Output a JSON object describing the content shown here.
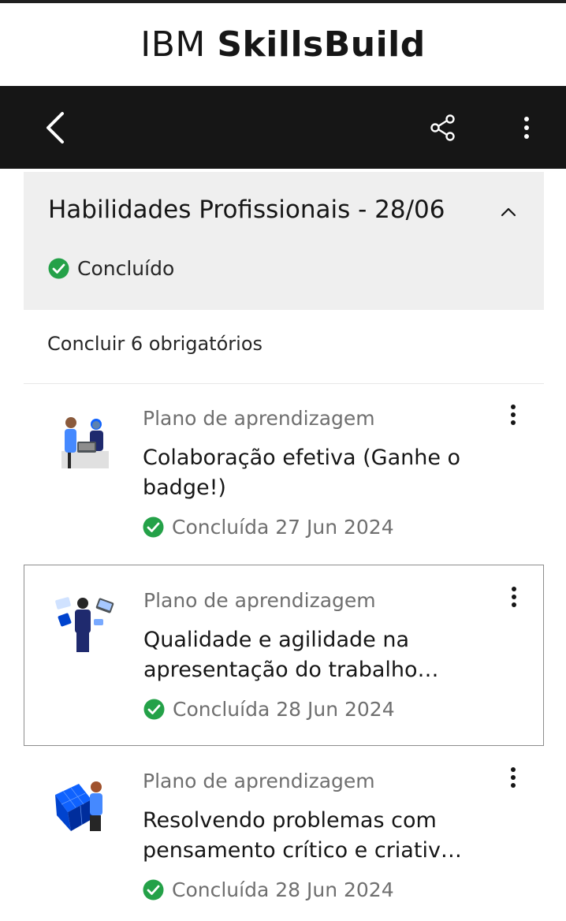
{
  "brand": {
    "ibm": "IBM",
    "skillsbuild": "SkillsBuild"
  },
  "toolbar": {
    "back_icon": "chevron-left-icon",
    "share_icon": "share-icon",
    "more_icon": "overflow-menu-icon"
  },
  "section": {
    "title": "Habilidades Profissionais - 28/06",
    "status": "Concluído",
    "collapse_icon": "chevron-up-icon"
  },
  "requirements": "Concluir 6 obrigatórios",
  "colors": {
    "toolbar_bg": "#161616",
    "section_bg": "#efefef",
    "success": "#24a148",
    "muted_text": "#6f6f6f"
  },
  "items": [
    {
      "type": "Plano de aprendizagem",
      "title": "Colaboração efetiva (Ganhe o badge!)",
      "status": "Concluída 27 Jun 2024",
      "thumb_icon": "collaboration-illustration"
    },
    {
      "type": "Plano de aprendizagem",
      "title": "Qualidade e agilidade na apresentação do trabalho…",
      "status": "Concluída 28 Jun 2024",
      "thumb_icon": "presentation-illustration"
    },
    {
      "type": "Plano de aprendizagem",
      "title": "Resolvendo problemas com pensamento crítico e criativ…",
      "status": "Concluída 28 Jun 2024",
      "thumb_icon": "problem-solving-illustration"
    }
  ]
}
